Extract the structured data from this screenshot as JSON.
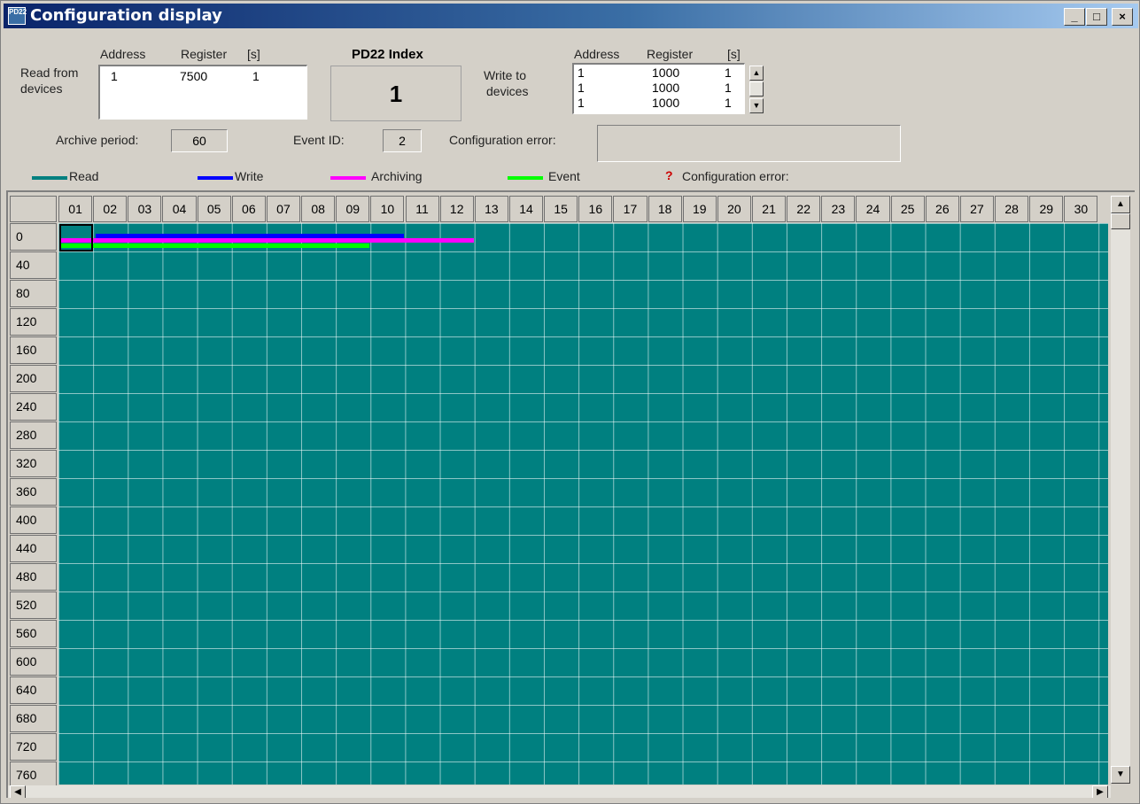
{
  "window": {
    "title": "Configuration display",
    "icon_label": "PD22",
    "minimize": "_",
    "maximize": "□",
    "close": "×"
  },
  "read_section": {
    "label_line1": "Read from",
    "label_line2": "devices",
    "col_address": "Address",
    "col_register": "Register",
    "col_s": "[s]",
    "rows": [
      {
        "address": "1",
        "register": "7500",
        "s": "1"
      }
    ]
  },
  "index_section": {
    "title": "PD22 Index",
    "value": "1"
  },
  "write_section": {
    "label_line1": "Write to",
    "label_line2": "devices",
    "col_address": "Address",
    "col_register": "Register",
    "col_s": "[s]",
    "rows": [
      {
        "address": "1",
        "register": "1000",
        "s": "1"
      },
      {
        "address": "1",
        "register": "1000",
        "s": "1"
      },
      {
        "address": "1",
        "register": "1000",
        "s": "1"
      }
    ]
  },
  "status": {
    "archive_period_label": "Archive period:",
    "archive_period_value": "60",
    "event_id_label": "Event ID:",
    "event_id_value": "2",
    "config_error_label": "Configuration error:",
    "config_error_value": ""
  },
  "legend": {
    "read": {
      "label": "Read",
      "color": "#008080"
    },
    "write": {
      "label": "Write",
      "color": "#0000ff"
    },
    "archiving": {
      "label": "Archiving",
      "color": "#ff00ff"
    },
    "event": {
      "label": "Event",
      "color": "#00ff00"
    },
    "config_error": {
      "label": "Configuration error:",
      "symbol": "?",
      "color": "#cc0000"
    }
  },
  "grid": {
    "columns": [
      "01",
      "02",
      "03",
      "04",
      "05",
      "06",
      "07",
      "08",
      "09",
      "10",
      "11",
      "12",
      "13",
      "14",
      "15",
      "16",
      "17",
      "18",
      "19",
      "20",
      "21",
      "22",
      "23",
      "24",
      "25",
      "26",
      "27",
      "28",
      "29",
      "30"
    ],
    "rows": [
      "0",
      "40",
      "80",
      "120",
      "160",
      "200",
      "240",
      "280",
      "320",
      "360",
      "400",
      "440",
      "480",
      "520",
      "560",
      "600",
      "640",
      "680",
      "720",
      "760"
    ],
    "background_color": "#008080",
    "bars": [
      {
        "type": "read",
        "row": "0",
        "from_col": "01",
        "to_col": "01",
        "color": "#008080"
      },
      {
        "type": "write",
        "row": "0",
        "from_col": "02",
        "to_col": "10",
        "color": "#0000ff"
      },
      {
        "type": "archiving",
        "row": "0",
        "from_col": "01",
        "to_col": "12",
        "color": "#ff00ff"
      },
      {
        "type": "event",
        "row": "0",
        "from_col": "01",
        "to_col": "09",
        "color": "#00ff00"
      }
    ]
  }
}
